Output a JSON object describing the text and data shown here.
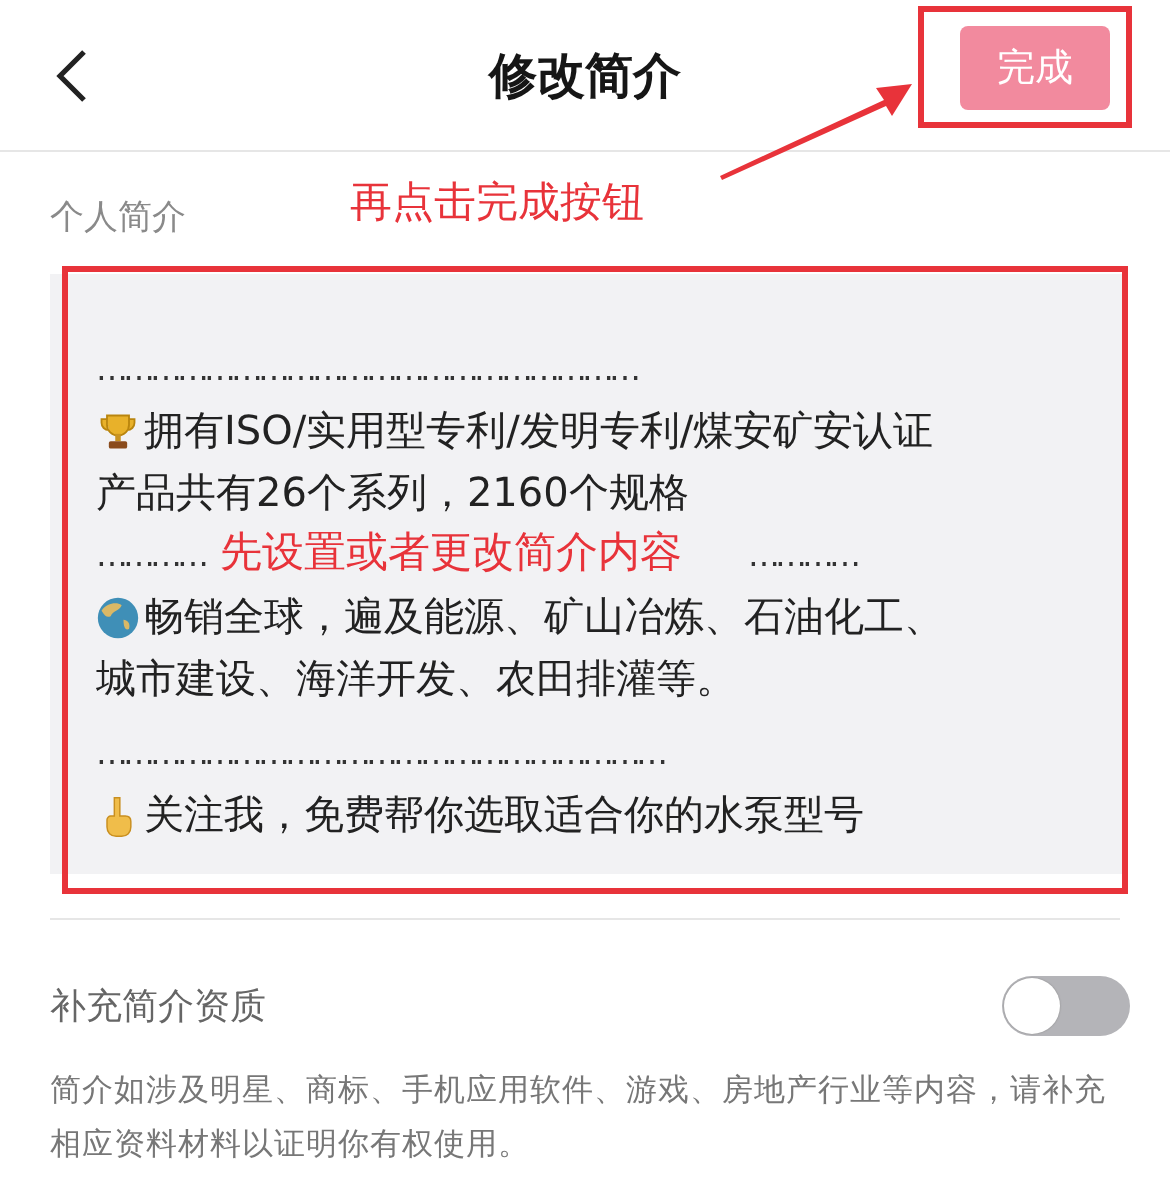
{
  "header": {
    "title": "修改简介",
    "done_button": {
      "label": "完成",
      "disabled": true
    }
  },
  "bio": {
    "label": "个人简介",
    "paragraphs": [
      {
        "kind": "dots",
        "text": "……………………………………………………"
      },
      {
        "kind": "item",
        "lines": [
          "拥有ISO/实用型专利/发明专利/煤安矿安认证",
          "产品共有26个系列，2160个规格"
        ]
      },
      {
        "kind": "split_dots",
        "parts": [
          "…………",
          "…………"
        ]
      },
      {
        "kind": "item",
        "lines": [
          "畅销全球，遍及能源、矿山冶炼、石油化工、",
          "城市建设、海洋开发、农田排灌等。"
        ]
      },
      {
        "kind": "gap"
      },
      {
        "kind": "dots",
        "text": "………………………………………………………"
      },
      {
        "kind": "item",
        "lines": [
          "关注我，免费帮你选取适合你的水泵型号"
        ]
      }
    ]
  },
  "qualification": {
    "label": "补充简介资质",
    "checked": false,
    "note": "简介如涉及明星、商标、手机应用软件、游戏、房地产行业等内容，请补充相应资料材料以证明你有权使用。"
  },
  "annotations": [
    {
      "kind": "button_callout",
      "text": "再点击完成按钮"
    },
    {
      "kind": "field_callout",
      "text": "先设置或者更改简介内容"
    }
  ]
}
